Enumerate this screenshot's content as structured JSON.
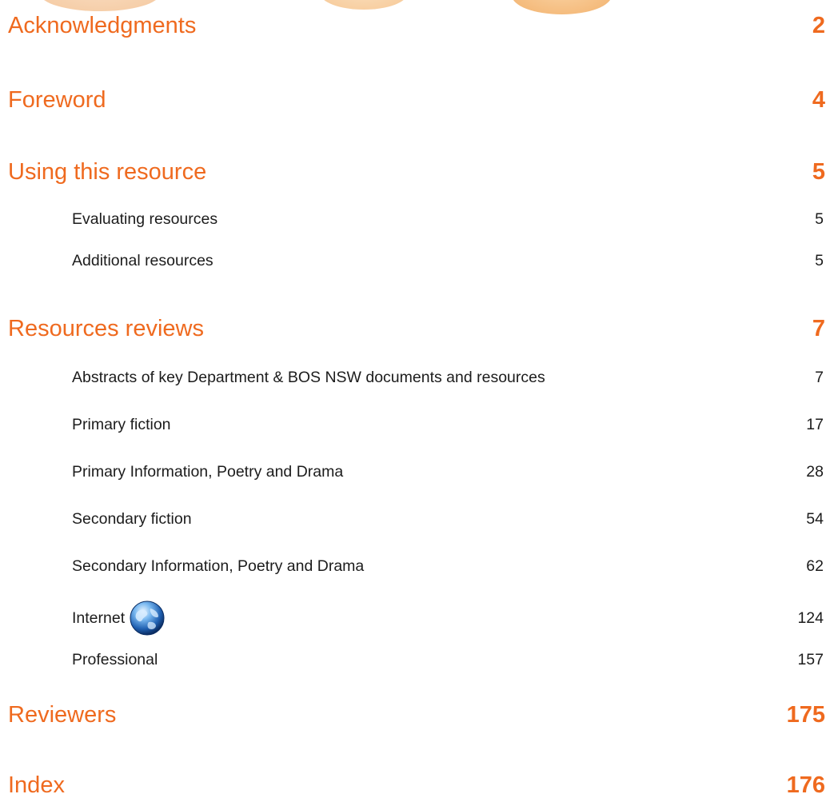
{
  "toc": {
    "entries": [
      {
        "label": "Acknowledgments",
        "page": "2"
      },
      {
        "label": "Foreword",
        "page": "4"
      },
      {
        "label": "Using this resource",
        "page": "5"
      },
      {
        "label": "Evaluating resources",
        "page": "5"
      },
      {
        "label": "Additional resources",
        "page": "5"
      },
      {
        "label": "Resources reviews",
        "page": "7"
      },
      {
        "label": "Abstracts of key Department & BOS NSW documents and resources",
        "page": "7"
      },
      {
        "label": "Primary fiction",
        "page": "17"
      },
      {
        "label": "Primary Information, Poetry and Drama",
        "page": "28"
      },
      {
        "label": "Secondary fiction",
        "page": "54"
      },
      {
        "label": "Secondary Information, Poetry and Drama",
        "page": "62"
      },
      {
        "label": "Internet",
        "page": "124",
        "icon": "globe-icon"
      },
      {
        "label": "Professional",
        "page": "157"
      },
      {
        "label": "Reviewers",
        "page": "175"
      },
      {
        "label": "Index",
        "page": "176"
      }
    ]
  },
  "colors": {
    "heading": "#ef6a1f",
    "subentry_text": "#1c1c1c",
    "decor_peach": "#f6cfaa",
    "decor_orange": "#f4b979"
  }
}
